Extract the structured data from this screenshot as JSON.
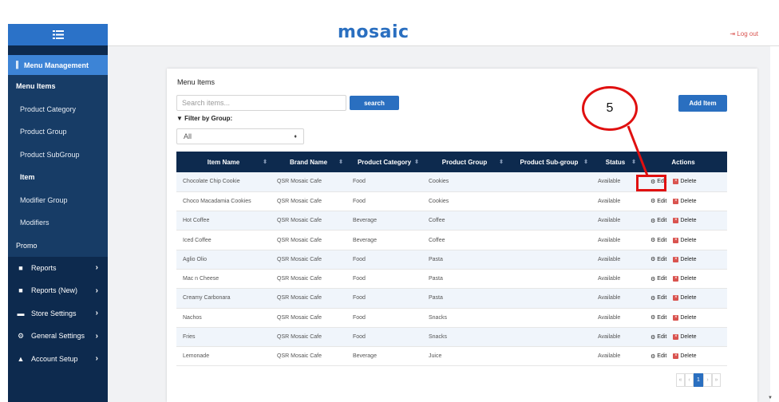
{
  "header": {
    "logo": "mosaic",
    "logout": "Log out",
    "logout_icon": "sign-out-icon"
  },
  "sidebar": {
    "toggle_icon": "list-icon",
    "active_section": {
      "label": "Menu Management",
      "icon": "cutlery-icon"
    },
    "menu_items_label": "Menu Items",
    "sub_items": [
      {
        "label": "Product Category"
      },
      {
        "label": "Product Group"
      },
      {
        "label": "Product SubGroup"
      },
      {
        "label": "Item"
      },
      {
        "label": "Modifier Group"
      },
      {
        "label": "Modifiers"
      }
    ],
    "promo_label": "Promo",
    "main_items": [
      {
        "label": "Reports",
        "icon": "file-icon"
      },
      {
        "label": "Reports (New)",
        "icon": "file-icon"
      },
      {
        "label": "Store Settings",
        "icon": "credit-card-icon"
      },
      {
        "label": "General Settings",
        "icon": "gear-icon"
      },
      {
        "label": "Account Setup",
        "icon": "user-icon"
      }
    ]
  },
  "main": {
    "title": "Menu Items",
    "search_placeholder": "Search items...",
    "search_button": "search",
    "filter_label": "Filter by Group:",
    "filter_value": "All",
    "add_button": "Add Item",
    "columns": [
      "Item Name",
      "Brand Name",
      "Product Category",
      "Product Group",
      "Product Sub-group",
      "Status",
      "Actions"
    ],
    "rows": [
      {
        "item": "Chocolate Chip Cookie",
        "brand": "QSR Mosaic Cafe",
        "category": "Food",
        "group": "Cookies",
        "subgroup": "",
        "status": "Available"
      },
      {
        "item": "Choco Macadamia Cookies",
        "brand": "QSR Mosaic Cafe",
        "category": "Food",
        "group": "Cookies",
        "subgroup": "",
        "status": "Available"
      },
      {
        "item": "Hot Coffee",
        "brand": "QSR Mosaic Cafe",
        "category": "Beverage",
        "group": "Coffee",
        "subgroup": "",
        "status": "Available"
      },
      {
        "item": "Iced Coffee",
        "brand": "QSR Mosaic Cafe",
        "category": "Beverage",
        "group": "Coffee",
        "subgroup": "",
        "status": "Available"
      },
      {
        "item": "Aglio Olio",
        "brand": "QSR Mosaic Cafe",
        "category": "Food",
        "group": "Pasta",
        "subgroup": "",
        "status": "Available"
      },
      {
        "item": "Mac n Cheese",
        "brand": "QSR Mosaic Cafe",
        "category": "Food",
        "group": "Pasta",
        "subgroup": "",
        "status": "Available"
      },
      {
        "item": "Creamy Carbonara",
        "brand": "QSR Mosaic Cafe",
        "category": "Food",
        "group": "Pasta",
        "subgroup": "",
        "status": "Available"
      },
      {
        "item": "Nachos",
        "brand": "QSR Mosaic Cafe",
        "category": "Food",
        "group": "Snacks",
        "subgroup": "",
        "status": "Available"
      },
      {
        "item": "Fries",
        "brand": "QSR Mosaic Cafe",
        "category": "Food",
        "group": "Snacks",
        "subgroup": "",
        "status": "Available"
      },
      {
        "item": "Lemonade",
        "brand": "QSR Mosaic Cafe",
        "category": "Beverage",
        "group": "Juice",
        "subgroup": "",
        "status": "Available"
      }
    ],
    "edit_label": "Edit",
    "delete_label": "Delete",
    "pagination": {
      "first": "«",
      "prev": "‹",
      "current": "1",
      "next": "›",
      "last": "»"
    }
  },
  "annotation": {
    "callout_number": "5"
  },
  "colors": {
    "accent": "#2a6fc0",
    "sidebar": "#0d2a4e",
    "sidebar_active": "#3d84d6",
    "danger": "#d9534f",
    "callout": "#e01010"
  }
}
